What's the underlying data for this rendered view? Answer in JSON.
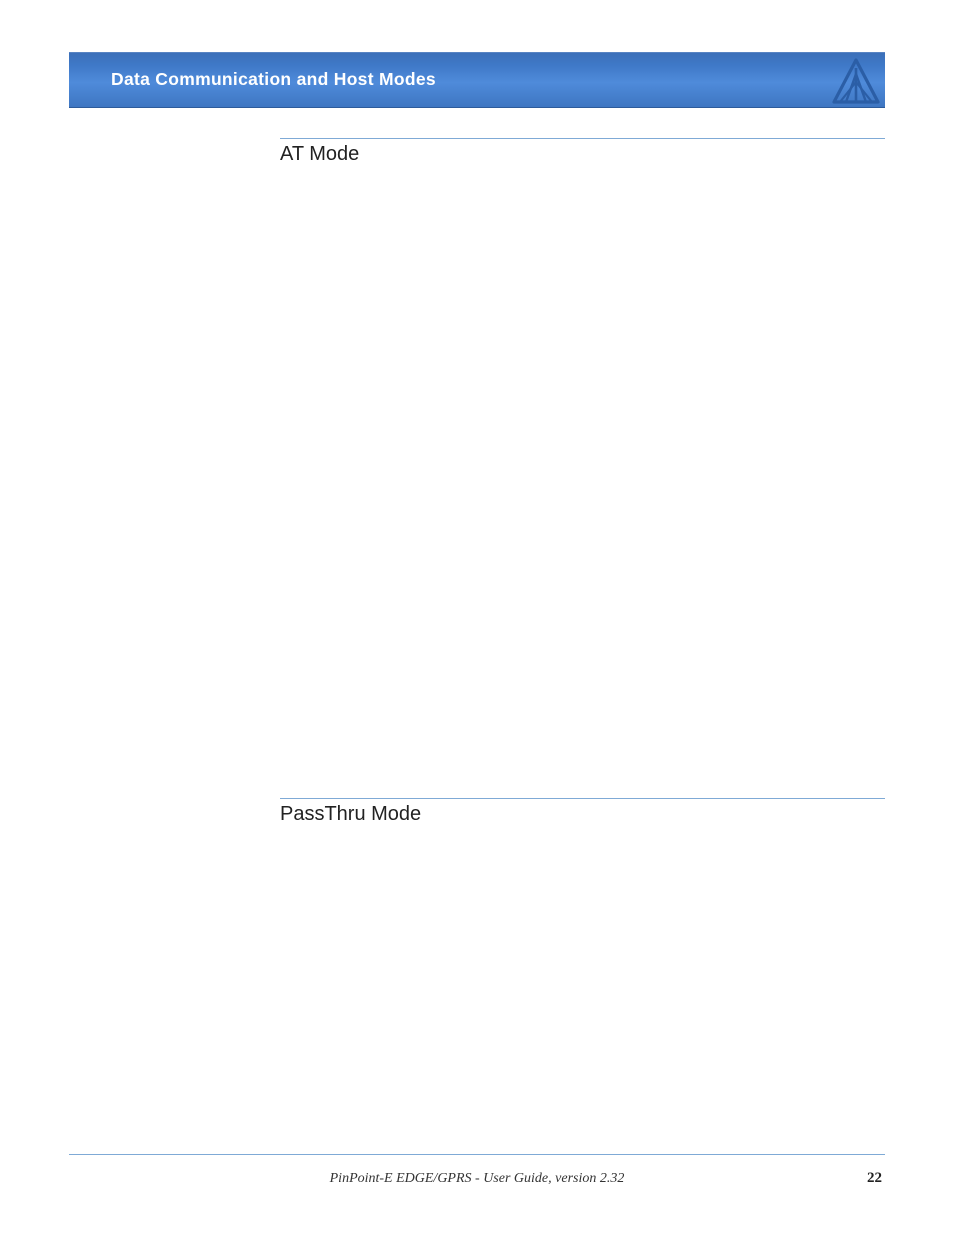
{
  "header": {
    "title": "Data Communication  and Host Modes"
  },
  "sections": {
    "s1": "AT Mode",
    "s2": "PassThru Mode"
  },
  "footer": {
    "doc": "PinPoint-E EDGE/GPRS - User Guide, version 2.32",
    "page": "22"
  },
  "logo": {
    "name": "brand-logo"
  }
}
